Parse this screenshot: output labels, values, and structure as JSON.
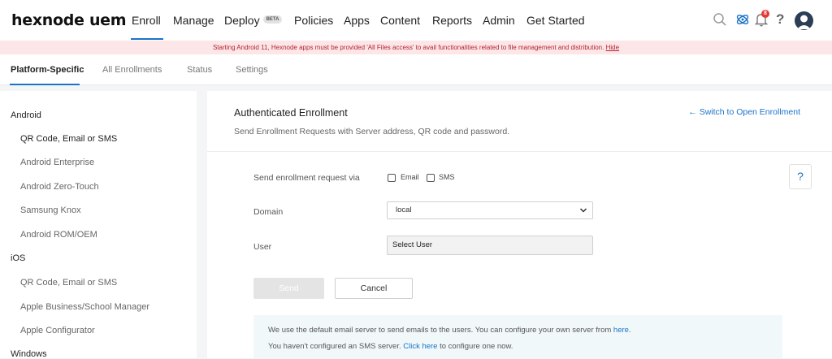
{
  "app": {
    "logo": "hexnode uem"
  },
  "nav": {
    "items": [
      {
        "label": "Enroll"
      },
      {
        "label": "Manage"
      },
      {
        "label": "Deploy",
        "badge": "BETA"
      },
      {
        "label": "Policies"
      },
      {
        "label": "Apps"
      },
      {
        "label": "Content"
      },
      {
        "label": "Reports"
      },
      {
        "label": "Admin"
      },
      {
        "label": "Get Started"
      }
    ],
    "notification_count": "8",
    "help_label": "?"
  },
  "banner": {
    "text": "Starting Android 11, Hexnode apps must be provided  'All Files access'  to avail functionalities related to file management and distribution.",
    "link": "Hide"
  },
  "subtabs": [
    "Platform-Specific",
    "All Enrollments",
    "Status",
    "Settings"
  ],
  "sidebar": {
    "android": {
      "heading": "Android",
      "items": [
        "QR Code, Email or SMS",
        "Android Enterprise",
        "Android Zero-Touch",
        "Samsung Knox",
        "Android ROM/OEM"
      ]
    },
    "ios": {
      "heading": "iOS",
      "items": [
        "QR Code, Email or SMS",
        "Apple Business/School Manager",
        "Apple Configurator"
      ]
    },
    "windows": {
      "heading": "Windows"
    }
  },
  "main": {
    "title": "Authenticated Enrollment",
    "subtitle": "Send Enrollment Requests with Server address, QR code and password.",
    "switch_link": "Switch to Open Enrollment",
    "help": "?",
    "form": {
      "send_via_label": "Send enrollment request via",
      "email_label": "Email",
      "sms_label": "SMS",
      "domain_label": "Domain",
      "domain_value": "local",
      "user_label": "User",
      "user_value": "Select User"
    },
    "buttons": {
      "send": "Send",
      "cancel": "Cancel"
    },
    "info": {
      "line1_text": "We use the default email server to send emails to the users. You can configure your own server from ",
      "line1_link": "here",
      "line1_end": ".",
      "line2_text": "You haven't configured an SMS server. ",
      "line2_link": "Click here",
      "line2_end": " to configure one now."
    }
  },
  "colors": {
    "accent": "#1a73c8",
    "banner_bg": "#fde6e7",
    "banner_text": "#b4232f",
    "badge": "#e53935"
  }
}
